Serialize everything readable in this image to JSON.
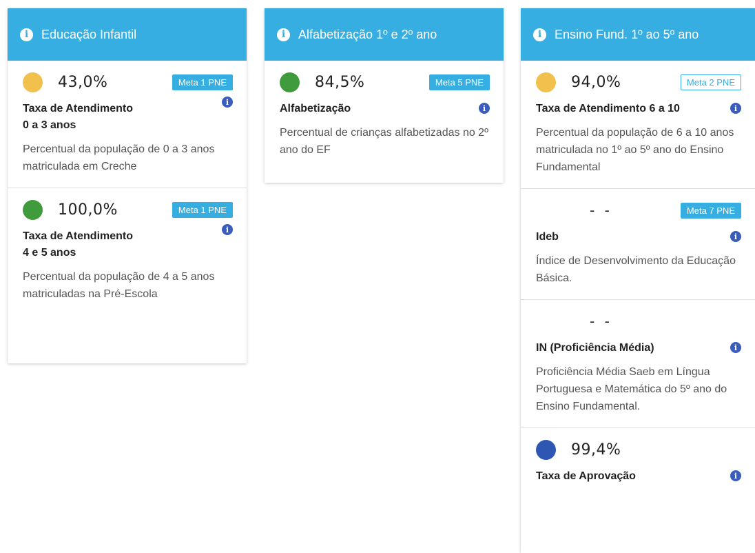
{
  "columns": [
    {
      "title": "Educação Infantil",
      "cards": [
        {
          "dot_color": "#f2c04c",
          "value": "43,0%",
          "meta": "Meta 1 PNE",
          "meta_style": "filled",
          "title_line1": "Taxa de Atendimento",
          "title_line2": "0 a 3 anos",
          "description": "Percentual da população de 0 a 3 anos matriculada em Creche"
        },
        {
          "dot_color": "#3f9b3c",
          "value": "100,0%",
          "meta": "Meta 1 PNE",
          "meta_style": "filled",
          "title_line1": "Taxa de Atendimento",
          "title_line2": "4 e 5 anos",
          "description": "Percentual da população de 4 a 5 anos matriculadas na Pré-Escola"
        }
      ]
    },
    {
      "title": "Alfabetização 1º e 2º ano",
      "cards": [
        {
          "dot_color": "#3f9b3c",
          "value": "84,5%",
          "meta": "Meta 5 PNE",
          "meta_style": "filled",
          "title_line1": "Alfabetização",
          "title_line2": "",
          "description": "Percentual de crianças alfabetizadas no 2º ano do EF"
        }
      ]
    },
    {
      "title": "Ensino Fund. 1º ao 5º ano",
      "cards": [
        {
          "dot_color": "#f2c04c",
          "value": "94,0%",
          "meta": "Meta 2 PNE",
          "meta_style": "outline",
          "title_line1": "Taxa de Atendimento 6 a 10",
          "title_line2": "",
          "description": "Percentual da população de 6 a 10 anos matriculada no 1º ao 5º ano do Ensino Fundamental"
        },
        {
          "dot_color": "",
          "value": "- -",
          "meta": "Meta 7 PNE",
          "meta_style": "filled",
          "title_line1": "Ideb",
          "title_line2": "",
          "description": "Índice de Desenvolvimento da Educação Básica."
        },
        {
          "dot_color": "",
          "value": "- -",
          "meta": "",
          "meta_style": "filled",
          "title_line1": "IN (Proficiência Média)",
          "title_line2": "",
          "description": "Proficiência Média Saeb em Língua Portuguesa e Matemática do 5º ano do Ensino Fundamental."
        },
        {
          "dot_color": "#2e57b3",
          "value": "99,4%",
          "meta": "",
          "meta_style": "filled",
          "title_line1": "Taxa de Aprovação",
          "title_line2": "",
          "description": ""
        }
      ]
    }
  ],
  "icons": {
    "header_info": "info-icon",
    "card_info": "info-icon",
    "header_glyph": "i"
  },
  "colors": {
    "header_bg": "#37aee2",
    "info_blue": "#3a5dbd"
  }
}
